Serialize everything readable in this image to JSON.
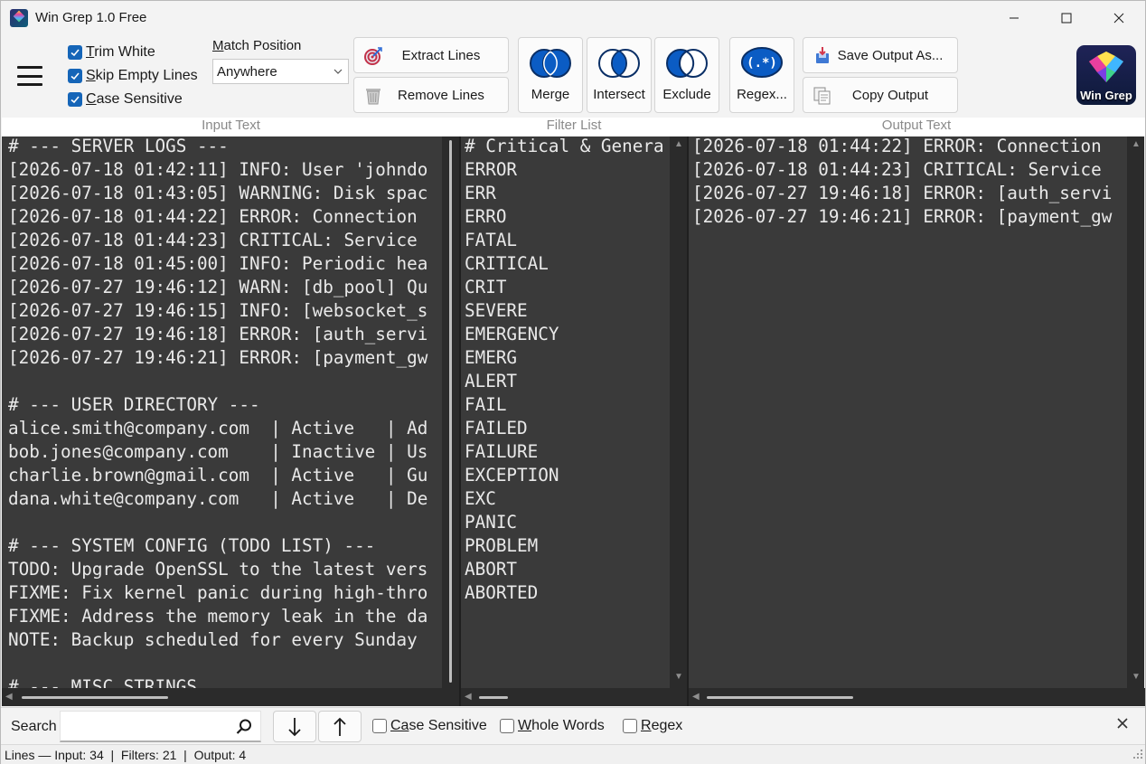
{
  "window": {
    "title": "Win Grep 1.0 Free"
  },
  "options": {
    "trim_white": {
      "label": "Trim White",
      "mnemonic": "T",
      "rest": "rim White",
      "checked": true
    },
    "skip_empty": {
      "label": "Skip Empty Lines",
      "mnemonic": "S",
      "rest": "kip Empty Lines",
      "checked": true
    },
    "case_sensitive": {
      "label": "Case Sensitive",
      "mnemonic": "C",
      "rest": "ase Sensitive",
      "checked": true
    }
  },
  "match_position": {
    "label": "Match Position",
    "mnemonic": "M",
    "rest": "atch Position",
    "value": "Anywhere"
  },
  "toolbar": {
    "extract_lines": "Extract Lines",
    "remove_lines": "Remove Lines",
    "merge": "Merge",
    "intersect": "Intersect",
    "exclude": "Exclude",
    "regex": "Regex...",
    "regex_icon_text": "(.*)",
    "save_output": "Save Output As...",
    "copy_output": "Copy Output"
  },
  "logo": {
    "text": "Win Grep"
  },
  "panels": {
    "input_header": "Input Text",
    "filter_header": "Filter List",
    "output_header": "Output Text"
  },
  "input_lines": [
    "# --- SERVER LOGS ---",
    "[2026-07-18 01:42:11] INFO: User 'johndo",
    "[2026-07-18 01:43:05] WARNING: Disk spac",
    "[2026-07-18 01:44:22] ERROR: Connection ",
    "[2026-07-18 01:44:23] CRITICAL: Service ",
    "[2026-07-18 01:45:00] INFO: Periodic hea",
    "[2026-07-27 19:46:12] WARN: [db_pool] Qu",
    "[2026-07-27 19:46:15] INFO: [websocket_s",
    "[2026-07-27 19:46:18] ERROR: [auth_servi",
    "[2026-07-27 19:46:21] ERROR: [payment_gw",
    "",
    "# --- USER DIRECTORY ---",
    "alice.smith@company.com  | Active   | Ad",
    "bob.jones@company.com    | Inactive | Us",
    "charlie.brown@gmail.com  | Active   | Gu",
    "dana.white@company.com   | Active   | De",
    "",
    "# --- SYSTEM CONFIG (TODO LIST) ---",
    "TODO: Upgrade OpenSSL to the latest vers",
    "FIXME: Fix kernel panic during high-thro",
    "FIXME: Address the memory leak in the da",
    "NOTE: Backup scheduled for every Sunday ",
    "",
    "# --- MISC STRINGS"
  ],
  "filter_lines": [
    "# Critical & Genera",
    "ERROR",
    "ERR",
    "ERRO",
    "FATAL",
    "CRITICAL",
    "CRIT",
    "SEVERE",
    "EMERGENCY",
    "EMERG",
    "ALERT",
    "FAIL",
    "FAILED",
    "FAILURE",
    "EXCEPTION",
    "EXC",
    "PANIC",
    "PROBLEM",
    "ABORT",
    "ABORTED"
  ],
  "output_lines": [
    "[2026-07-18 01:44:22] ERROR: Connection",
    "[2026-07-18 01:44:23] CRITICAL: Service",
    "[2026-07-27 19:46:18] ERROR: [auth_servi",
    "[2026-07-27 19:46:21] ERROR: [payment_gw"
  ],
  "search": {
    "label": "Search",
    "value": "",
    "case_sensitive": {
      "mnemonic": "Ca",
      "prefix": "",
      "rest": "se Sensitive",
      "label": "Case Sensitive",
      "checked": false
    },
    "whole_words": {
      "mnemonic": "W",
      "rest": "hole Words",
      "label": "Whole Words",
      "checked": false
    },
    "regex": {
      "mnemonic": "R",
      "rest": "egex",
      "label": "Regex",
      "checked": false
    }
  },
  "status": {
    "text": "Lines — Input: 34  |  Filters: 21  |  Output: 4"
  },
  "colors": {
    "accent": "#1565b8",
    "panel_bg": "#3a3a3a",
    "venn_blue": "#0b5cc4"
  }
}
